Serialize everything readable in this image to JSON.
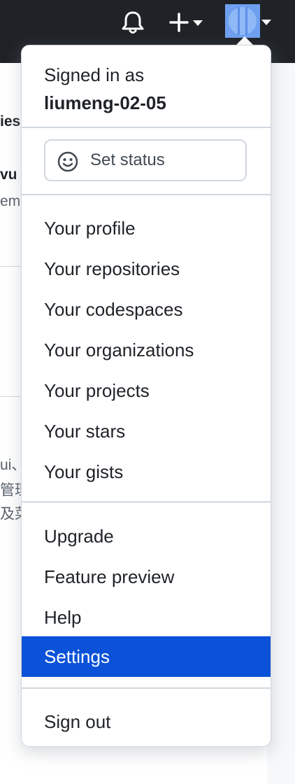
{
  "header": {
    "icons": [
      "bell-icon",
      "plus-icon",
      "caret-down-icon",
      "avatar"
    ]
  },
  "background_fragments": [
    "ies",
    "vu",
    "em",
    "ui、",
    "管理",
    "及菜"
  ],
  "dropdown": {
    "signed_in_label": "Signed in as",
    "username": "liumeng-02-05",
    "set_status_label": "Set status",
    "profile_items": [
      "Your profile",
      "Your repositories",
      "Your codespaces",
      "Your organizations",
      "Your projects",
      "Your stars",
      "Your gists"
    ],
    "secondary_items": [
      "Upgrade",
      "Feature preview",
      "Help",
      "Settings"
    ],
    "sign_out_label": "Sign out",
    "active_item": "Settings"
  },
  "colors": {
    "header_bg": "#1f2328",
    "active_bg": "#0b52d8",
    "avatar": "#6fa0f0"
  }
}
